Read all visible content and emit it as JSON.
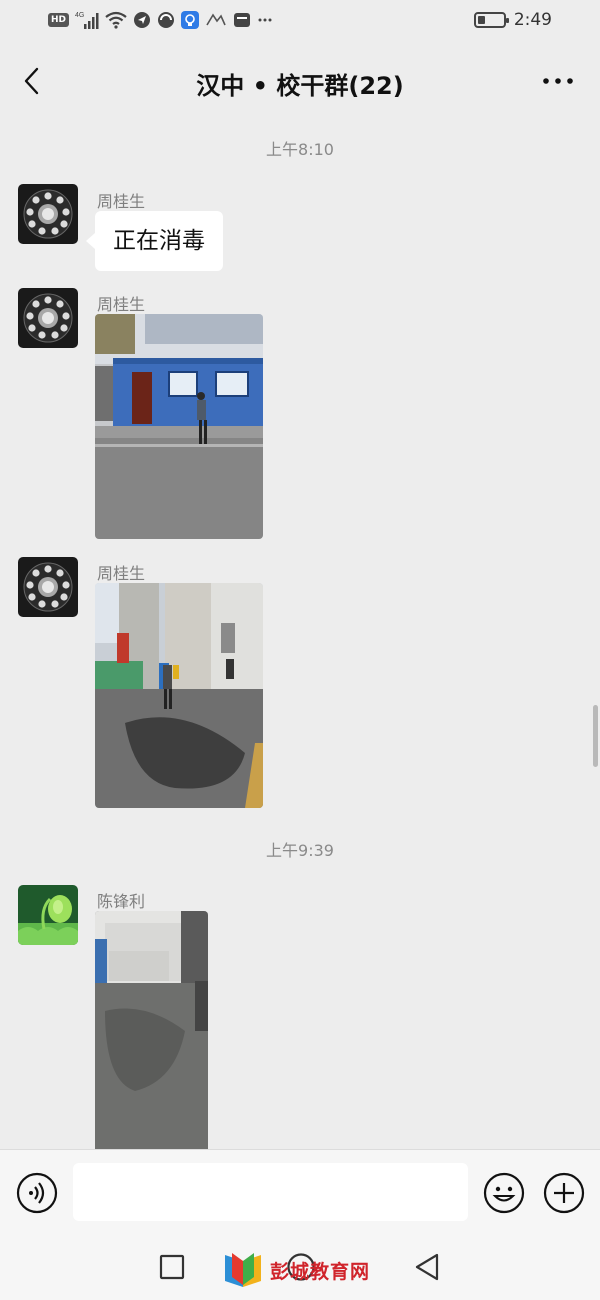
{
  "status_bar": {
    "time": "2:49",
    "hd_label": "HD",
    "network_label": "4G",
    "icons": [
      "hd-icon",
      "cellular-signal-icon",
      "wifi-icon",
      "paper-plane-icon",
      "app-icon",
      "lightbulb-icon",
      "app-icon",
      "app-icon",
      "more-notifications-icon",
      "battery-icon"
    ],
    "battery_level": 0.3
  },
  "header": {
    "title": "汉中 • 校干群(22)",
    "back_icon": "chevron-left-icon",
    "more_icon": "more-dots-icon"
  },
  "chat": {
    "timestamps": [
      "上午8:10",
      "上午9:39"
    ],
    "messages": [
      {
        "sender": "周桂生",
        "type": "text",
        "text": "正在消毒",
        "avatar": "rotary-dial-avatar"
      },
      {
        "sender": "周桂生",
        "type": "image",
        "image": "photo-blue-container-disinfection",
        "avatar": "rotary-dial-avatar"
      },
      {
        "sender": "周桂生",
        "type": "image",
        "image": "photo-gate-disinfection",
        "avatar": "rotary-dial-avatar"
      },
      {
        "sender": "陈锋利",
        "type": "image",
        "image": "photo-wet-floor-room",
        "avatar": "sprout-avatar"
      }
    ]
  },
  "input_bar": {
    "voice_icon": "voice-icon",
    "emoji_icon": "emoji-icon",
    "plus_icon": "plus-icon",
    "placeholder": ""
  },
  "nav_bar": {
    "icons": [
      "square-icon",
      "circle-icon",
      "triangle-back-icon"
    ],
    "watermark_text": "彭城教育网"
  },
  "colors": {
    "background": "#ededed",
    "bubble": "#ffffff",
    "watermark_red": "#d0242b"
  }
}
